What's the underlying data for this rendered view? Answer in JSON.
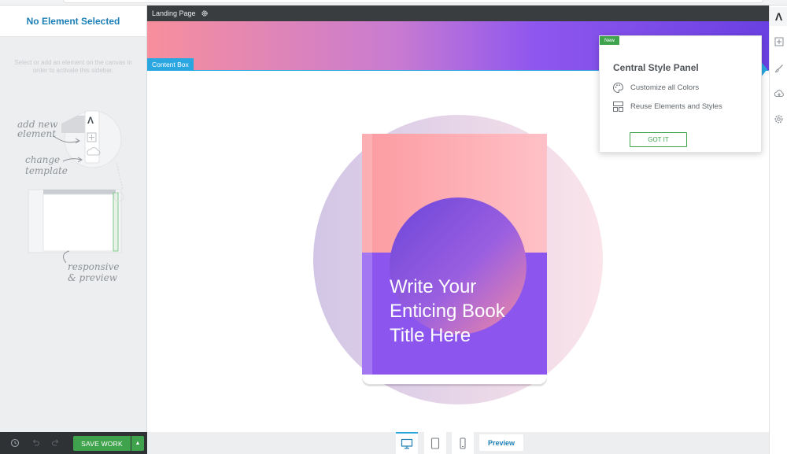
{
  "sidebar": {
    "title": "No Element Selected",
    "hint": "Select or add an element on the canvas in order to activate this sidebar.",
    "illustration": {
      "add_new": [
        "add new",
        "element"
      ],
      "change_template": [
        "change",
        "template"
      ],
      "responsive": [
        "responsive",
        "& preview"
      ]
    }
  },
  "bottom_bar": {
    "save_label": "SAVE WORK"
  },
  "canvas": {
    "page_name": "Landing Page",
    "content_box_label": "Content Box",
    "book_title_lines": [
      "Write Your",
      "Enticing Book",
      "Title Here"
    ]
  },
  "device_bar": {
    "preview_label": "Preview",
    "active_device": "desktop"
  },
  "popup": {
    "badge": "New",
    "title": "Central Style Panel",
    "items": [
      {
        "icon": "palette-icon",
        "label": "Customize all Colors"
      },
      {
        "icon": "layout-blocks-icon",
        "label": "Reuse Elements and Styles"
      }
    ],
    "button": "GOT IT"
  },
  "right_toolbar": {
    "icons": [
      "thrive-logo-icon",
      "add-element-icon",
      "brush-icon",
      "cloud-download-icon",
      "gear-icon"
    ]
  },
  "colors": {
    "accent_blue": "#2aa6e0",
    "save_green": "#3fa34d",
    "title_blue": "#1b7fb5",
    "book_pink": "#fd9aa1",
    "book_purple": "#8b55ee"
  }
}
